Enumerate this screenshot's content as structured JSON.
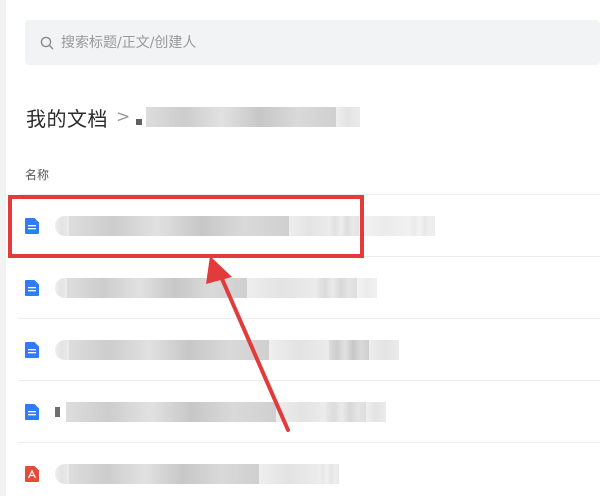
{
  "search": {
    "placeholder": "搜索标题/正文/创建人",
    "icon": "search-icon"
  },
  "breadcrumb": {
    "root": "我的文档",
    "separator": ">"
  },
  "list": {
    "column_name": "名称",
    "files": [
      {
        "type": "doc",
        "icon": "document-icon"
      },
      {
        "type": "doc",
        "icon": "document-icon"
      },
      {
        "type": "doc",
        "icon": "document-icon"
      },
      {
        "type": "doc",
        "icon": "document-icon"
      },
      {
        "type": "pdf",
        "icon": "pdf-icon"
      }
    ]
  },
  "colors": {
    "doc_icon": "#2f7cf6",
    "pdf_icon": "#e64a3b",
    "annotation": "#e23b3b",
    "search_bg": "#f2f3f5"
  }
}
